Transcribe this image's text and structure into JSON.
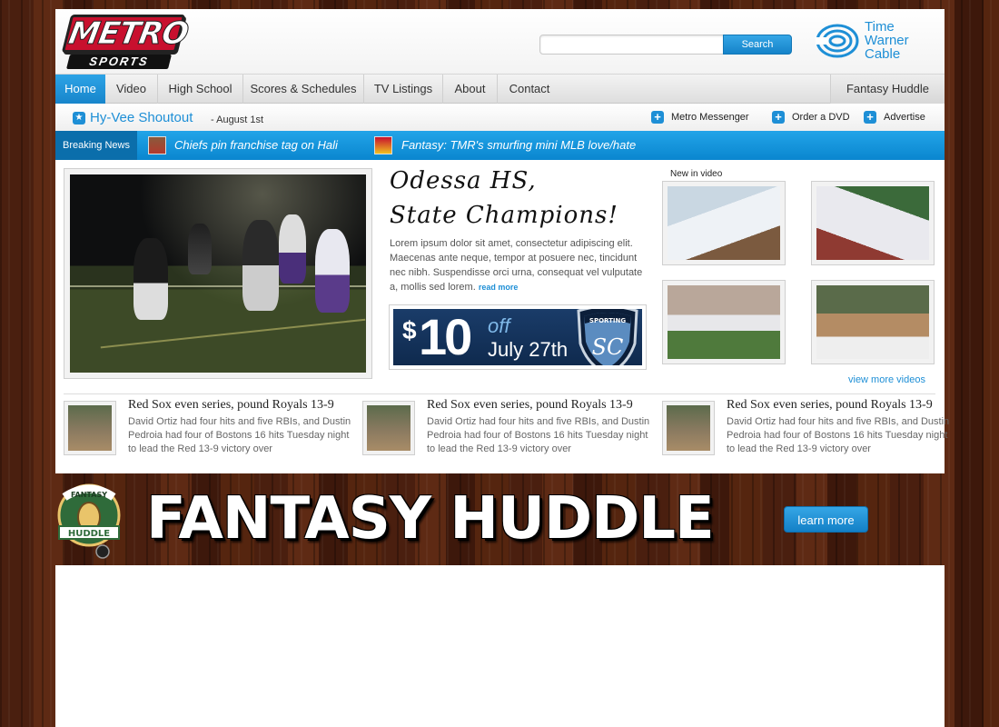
{
  "header": {
    "logo_top": "METRO",
    "logo_bottom": "SPORTS",
    "search_placeholder": "",
    "search_button": "Search",
    "sponsor_lines": [
      "Time",
      "Warner",
      "Cable"
    ]
  },
  "nav": {
    "items": [
      "Home",
      "Video",
      "High School",
      "Scores & Schedules",
      "TV Listings",
      "About",
      "Contact"
    ],
    "right": "Fantasy Huddle",
    "active": "Home"
  },
  "subbar": {
    "promo_title": "Hy-Vee Shoutout",
    "promo_date": "- August 1st",
    "links": [
      "Metro Messenger",
      "Order a DVD",
      "Advertise"
    ]
  },
  "breaking": {
    "label": "Breaking News",
    "items": [
      "Chiefs pin franchise tag on Hali",
      "Fantasy: TMR's smurfing mini MLB love/hate"
    ]
  },
  "feature": {
    "headline_line1": "Odessa HS,",
    "headline_line2": "State Champions!",
    "body": "Lorem ipsum dolor sit amet, consectetur adipiscing elit. Maecenas ante neque, tempor at posuere nec, tincidunt nec nibh. Suspendisse orci urna, consequat vel vulputate a, mollis sed lorem.",
    "read_more": "read more"
  },
  "promo_ad": {
    "dollar": "$",
    "amount": "10",
    "off": "off",
    "date": "July 27th",
    "crest_text": "SPORTING",
    "crest_initials": "SC"
  },
  "videos": {
    "label": "New in video",
    "view_more": "view more videos"
  },
  "stories": [
    {
      "title": "Red Sox even series, pound Royals 13-9",
      "body": "David Ortiz had four hits and five RBIs, and Dustin Pedroia had four of Bostons 16 hits Tuesday night to lead the Red 13-9 victory over"
    },
    {
      "title": "Red Sox even series, pound Royals 13-9",
      "body": "David Ortiz had four hits and five RBIs, and Dustin Pedroia had four of Bostons 16 hits Tuesday night to lead the Red 13-9 victory over"
    },
    {
      "title": "Red Sox even series, pound Royals 13-9",
      "body": "David Ortiz had four hits and five RBIs, and Dustin Pedroia had four of Bostons 16 hits Tuesday night to lead the Red 13-9 victory over"
    }
  ],
  "fantasy_banner": {
    "logo_top": "FANTASY",
    "logo_bottom": "HUDDLE",
    "title": "FANTASY HUDDLE",
    "button": "learn more"
  },
  "colors": {
    "accent_blue": "#1e8fd6",
    "logo_red": "#c8102e",
    "wood": "#4a1f0f"
  }
}
